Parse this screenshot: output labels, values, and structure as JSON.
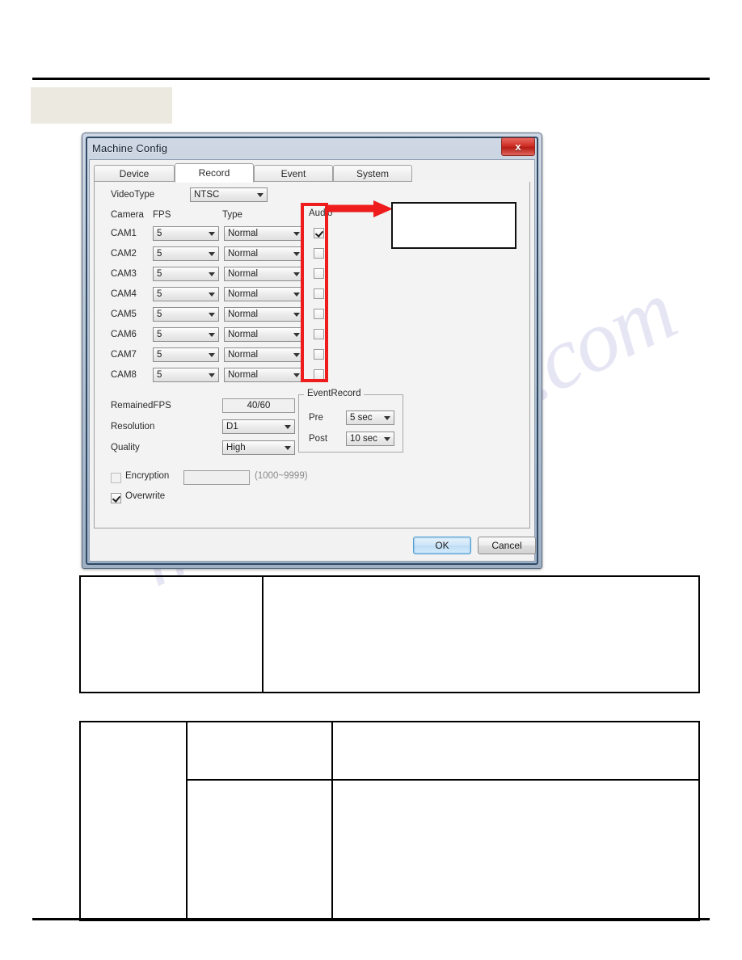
{
  "document": {
    "watermark_text": "manualshive.com",
    "heading_box_placeholder": ""
  },
  "dialog": {
    "title": "Machine Config",
    "close_label": "x",
    "tabs": [
      {
        "label": "Device",
        "active": false
      },
      {
        "label": "Record",
        "active": true
      },
      {
        "label": "Event",
        "active": false
      },
      {
        "label": "System",
        "active": false
      }
    ],
    "video_type": {
      "label": "VideoType",
      "value": "NTSC"
    },
    "columns": {
      "camera": "Camera",
      "fps": "FPS",
      "type": "Type",
      "audio": "Audio"
    },
    "cameras": [
      {
        "name": "CAM1",
        "fps": "5",
        "type": "Normal",
        "audio": true
      },
      {
        "name": "CAM2",
        "fps": "5",
        "type": "Normal",
        "audio": false
      },
      {
        "name": "CAM3",
        "fps": "5",
        "type": "Normal",
        "audio": false
      },
      {
        "name": "CAM4",
        "fps": "5",
        "type": "Normal",
        "audio": false
      },
      {
        "name": "CAM5",
        "fps": "5",
        "type": "Normal",
        "audio": false
      },
      {
        "name": "CAM6",
        "fps": "5",
        "type": "Normal",
        "audio": false
      },
      {
        "name": "CAM7",
        "fps": "5",
        "type": "Normal",
        "audio": false
      },
      {
        "name": "CAM8",
        "fps": "5",
        "type": "Normal",
        "audio": false
      }
    ],
    "remained_fps": {
      "label": "RemainedFPS",
      "value": "40/60"
    },
    "resolution": {
      "label": "Resolution",
      "value": "D1"
    },
    "quality": {
      "label": "Quality",
      "value": "High"
    },
    "event_record": {
      "title": "EventRecord",
      "pre_label": "Pre",
      "pre_value": "5 sec",
      "post_label": "Post",
      "post_value": "10 sec"
    },
    "encryption": {
      "label": "Encryption",
      "checked": false,
      "value": "",
      "hint": "(1000~9999)"
    },
    "overwrite": {
      "label": "Overwrite",
      "checked": true
    },
    "buttons": {
      "ok": "OK",
      "cancel": "Cancel"
    }
  },
  "annotation": {
    "highlight_color": "#ee1c1c",
    "callout_text": ""
  },
  "tables": {
    "table_one": {
      "rows": [
        {
          "cells": [
            "",
            ""
          ]
        }
      ]
    },
    "table_two": {
      "rows": [
        {
          "cells": [
            "",
            "",
            ""
          ]
        },
        {
          "cells": [
            "",
            ""
          ]
        }
      ]
    }
  }
}
